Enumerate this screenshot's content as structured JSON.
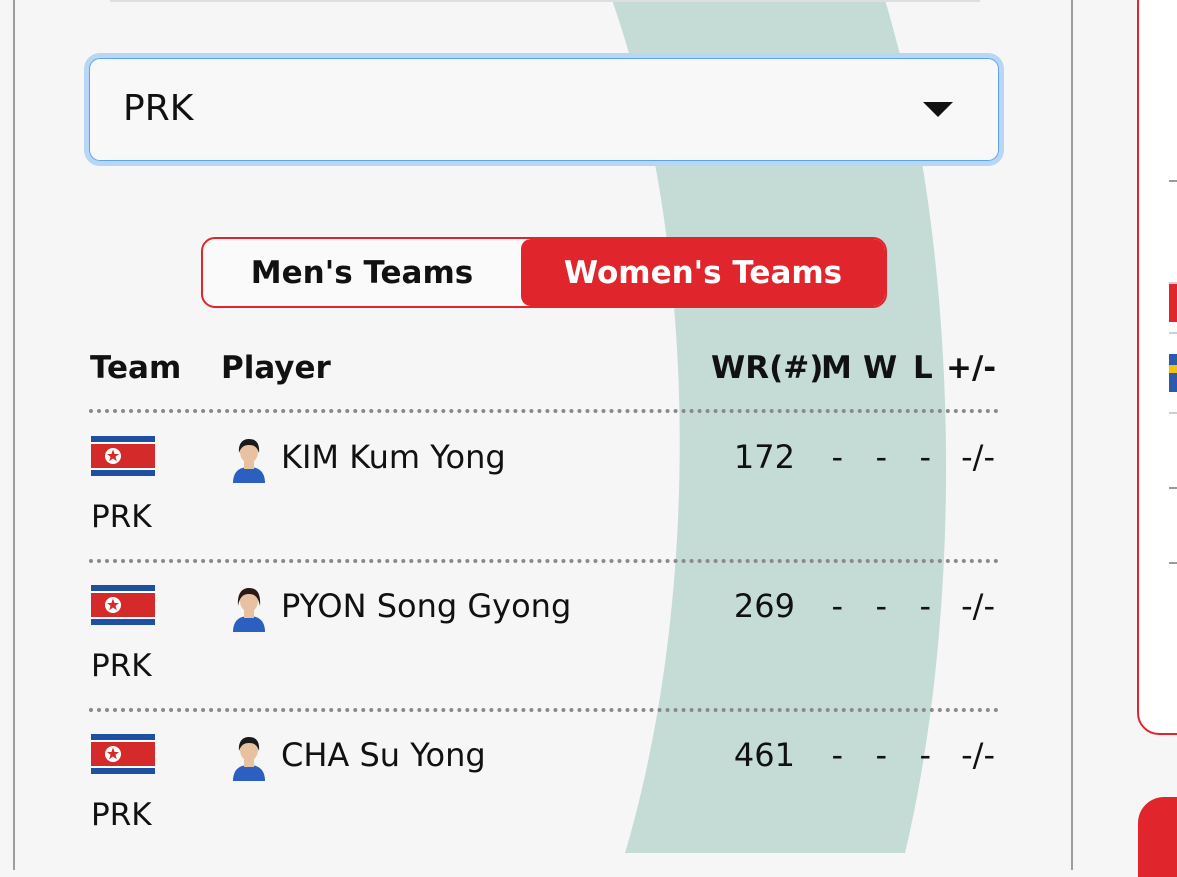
{
  "selector": {
    "value": "PRK"
  },
  "tabs": [
    {
      "label": "Men's Teams",
      "active": false
    },
    {
      "label": "Women's Teams",
      "active": true
    }
  ],
  "table": {
    "headers": {
      "team": "Team",
      "player": "Player",
      "wr": "WR(#)",
      "m": "M",
      "w": "W",
      "l": "L",
      "diff": "+/-"
    },
    "rows": [
      {
        "team": "PRK",
        "player": "KIM Kum Yong",
        "wr": "172",
        "m": "-",
        "w": "-",
        "l": "-",
        "diff": "-/-"
      },
      {
        "team": "PRK",
        "player": "PYON Song Gyong",
        "wr": "269",
        "m": "-",
        "w": "-",
        "l": "-",
        "diff": "-/-"
      },
      {
        "team": "PRK",
        "player": "CHA Su Yong",
        "wr": "461",
        "m": "-",
        "w": "-",
        "l": "-",
        "diff": "-/-"
      }
    ]
  },
  "colors": {
    "accent": "#e0262c",
    "focus": "#5ea3ec",
    "arc": "#c5dcd6"
  },
  "icons": {
    "flag": "prk-flag-icon",
    "avatar": "player-avatar-icon",
    "dropdown": "chevron-down-icon"
  }
}
